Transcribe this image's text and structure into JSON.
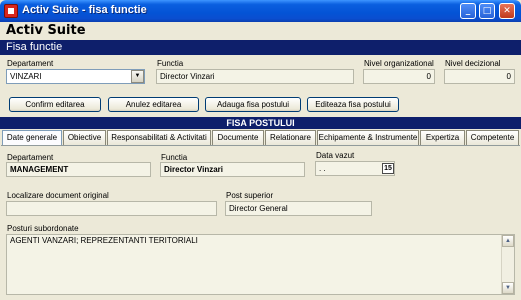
{
  "window": {
    "title": "Activ Suite - fisa functie",
    "controls": {
      "minimize": "_",
      "maximize": "□",
      "close": "✕"
    }
  },
  "app": {
    "name": "Activ Suite"
  },
  "form": {
    "title": "Fisa functie",
    "departament": {
      "label": "Departament",
      "value": "VINZARI"
    },
    "functia": {
      "label": "Functia",
      "value": "Director Vinzari"
    },
    "nivel_organizational": {
      "label": "Nivel organizational",
      "value": "0"
    },
    "nivel_decizional": {
      "label": "Nivel decizional",
      "value": "0"
    }
  },
  "buttons": {
    "confirm": "Confirm editarea",
    "anulez": "Anulez editarea",
    "adauga": "Adauga fisa postului",
    "editeaza": "Editeaza fisa postului"
  },
  "section": {
    "title": "FISA POSTULUI"
  },
  "tabs": [
    {
      "label": "Date generale",
      "active": true
    },
    {
      "label": "Obiective"
    },
    {
      "label": "Responsabilitati & Activitati"
    },
    {
      "label": "Documente"
    },
    {
      "label": "Relationare"
    },
    {
      "label": "Echipamente & Instrumente"
    },
    {
      "label": "Expertiza"
    },
    {
      "label": "Competente"
    }
  ],
  "details": {
    "departament": {
      "label": "Departament",
      "value": "MANAGEMENT"
    },
    "functia": {
      "label": "Functia",
      "value": "Director Vinzari"
    },
    "data_vazut": {
      "label": "Data vazut",
      "value": " .  . ",
      "calendar_icon": "15"
    },
    "localizare": {
      "label": "Localizare document original",
      "value": ""
    },
    "post_superior": {
      "label": "Post superior",
      "value": "Director General"
    },
    "posturi_subordonate": {
      "label": "Posturi subordonate",
      "value": "AGENTI VANZARI; REPREZENTANTI TERITORIALI"
    }
  },
  "icons": {
    "dropdown": "▼",
    "scroll_up": "▲",
    "scroll_down": "▼"
  },
  "colors": {
    "title_bar": "#0453d5",
    "banner": "#0e1f6b",
    "window_bg": "#ece9d8"
  }
}
